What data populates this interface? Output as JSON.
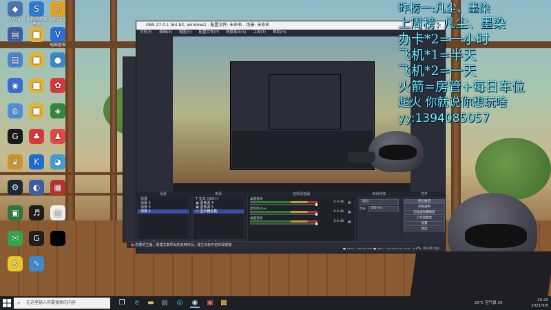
{
  "desktop_icons": [
    {
      "label": "Ultra",
      "glyph": "◆",
      "color": "#4a73b5"
    },
    {
      "label": "搜狗浏览器\n高速",
      "glyph": "S",
      "color": "#2b7bd1"
    },
    {
      "label": "福利驿站",
      "glyph": "◎",
      "color": "#e6a21e"
    },
    {
      "label": "",
      "glyph": "▤",
      "color": "#3d5fa8"
    },
    {
      "label": "",
      "glyph": "■",
      "color": "#e0b33a"
    },
    {
      "label": "电脑管家",
      "glyph": "V",
      "color": "#2c6fd6"
    },
    {
      "label": "",
      "glyph": "▤",
      "color": "#4a86c8"
    },
    {
      "label": "",
      "glyph": "■",
      "color": "#e0b33a"
    },
    {
      "label": "",
      "glyph": "●",
      "color": "#3a8acb"
    },
    {
      "label": "",
      "glyph": "◉",
      "color": "#3d6bd6"
    },
    {
      "label": "",
      "glyph": "■",
      "color": "#e0b33a"
    },
    {
      "label": "",
      "glyph": "✿",
      "color": "#d63a3a"
    },
    {
      "label": "",
      "glyph": "◍",
      "color": "#4a8fdc"
    },
    {
      "label": "",
      "glyph": "■",
      "color": "#e0b33a"
    },
    {
      "label": "",
      "glyph": "◈",
      "color": "#2f8a3a"
    },
    {
      "label": "",
      "glyph": "G",
      "color": "#1a1a1a"
    },
    {
      "label": "",
      "glyph": "♣",
      "color": "#d43a3a"
    },
    {
      "label": "",
      "glyph": "♟",
      "color": "#e24646"
    },
    {
      "label": "",
      "glyph": "♛",
      "color": "#c9962d"
    },
    {
      "label": "",
      "glyph": "K",
      "color": "#1a6fd6"
    },
    {
      "label": "",
      "glyph": "◕",
      "color": "#3aa0d6"
    },
    {
      "label": "",
      "glyph": "⚙",
      "color": "#1b2838"
    },
    {
      "label": "",
      "glyph": "◐",
      "color": "#3a5fa8"
    },
    {
      "label": "",
      "glyph": "▦",
      "color": "#c22e2e"
    },
    {
      "label": "",
      "glyph": "▣",
      "color": "#2a7a3a"
    },
    {
      "label": "",
      "glyph": "♬",
      "color": "#1d1d1d"
    },
    {
      "label": "",
      "glyph": "▧",
      "color": "#f0f0f0"
    },
    {
      "label": "",
      "glyph": "✉",
      "color": "#2ea84a"
    },
    {
      "label": "",
      "glyph": "G",
      "color": "#1f1f1f"
    },
    {
      "label": "",
      "glyph": "",
      "color": "#000000"
    },
    {
      "label": "",
      "glyph": "$",
      "color": "#e8c82a"
    },
    {
      "label": "",
      "glyph": "✎",
      "color": "#3a8bd6"
    }
  ],
  "obs": {
    "title": "OBS 27.0.1 (64-bit, windows) - 配置文件: 未命名 - 场景: 未命名",
    "menu": [
      "文件(F)",
      "编辑(E)",
      "视图(V)",
      "配置文件(P)",
      "场景集合(S)",
      "工具(T)",
      "帮助(H)"
    ],
    "status_bar": "● LIVE: 00:00:00   ● REC: 00:00:00   CPU: 1.4%, 60.00 fps",
    "docks": {
      "scenes": {
        "header": "场景",
        "items": [
          "场景",
          "场景 2",
          "场景 3",
          "场景 4"
        ]
      },
      "sources": {
        "header": "来源",
        "items": [
          "文本 (GDI+)",
          "图像源 4",
          "图像源 5",
          "显示器采集"
        ]
      },
      "mixer": {
        "header": "音频混音器",
        "channels": [
          {
            "name": "桌面音频",
            "db": "0.0 dB",
            "level": 0.95
          },
          {
            "name": "麦克风/Aux",
            "db": "0.0 dB",
            "level": 0.95
          },
          {
            "name": "桌面音频",
            "db": "0.0 dB",
            "level": 0.95
          }
        ]
      },
      "transitions": {
        "header": "转场特效",
        "type": "淡出",
        "duration_label": "时长",
        "duration": "300 ms"
      },
      "controls": {
        "header": "控件",
        "buttons": [
          "停止推流",
          "开始录制",
          "启动虚拟摄像机",
          "工作室模式",
          "设置",
          "退出"
        ]
      }
    },
    "notice": "您要的主播，助理文案导出的使用时间，建立目标开始实现链接"
  },
  "overlay_lines": [
    "昨榜一:凡尘、墨染",
    "上周榜: 凡尘、墨染",
    "办卡*2=一小时",
    "飞机*1=半天",
    "飞机*2=一天",
    "火箭=房管+每日车位",
    "超火 你就说你想玩啥",
    "yy:1394085057"
  ],
  "taskbar": {
    "search_placeholder": "在这里输入你要搜索的内容",
    "weather": "25°C 空气良 29",
    "time": "20:20",
    "date": "2021/9/5"
  }
}
